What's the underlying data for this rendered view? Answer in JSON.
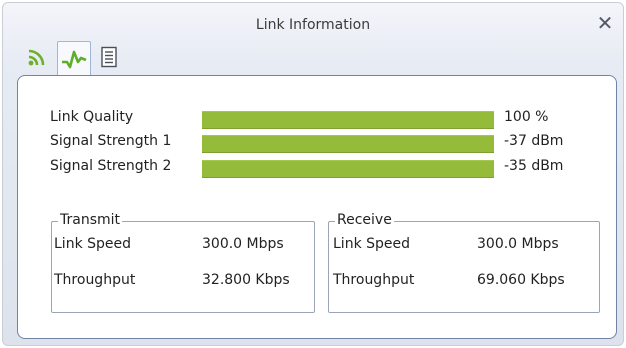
{
  "window": {
    "title": "Link Information",
    "close_glyph": "✕"
  },
  "tabs": [
    {
      "name": "signal-tab",
      "icon": "wifi-signal-icon"
    },
    {
      "name": "link-tab",
      "icon": "waveform-icon",
      "active": true
    },
    {
      "name": "info-tab",
      "icon": "document-icon"
    }
  ],
  "quality": [
    {
      "label": "Link Quality",
      "value": "100 %",
      "level": 1.0
    },
    {
      "label": "Signal Strength 1",
      "value": "-37 dBm",
      "level": 1.0
    },
    {
      "label": "Signal Strength 2",
      "value": "-35 dBm",
      "level": 1.0
    }
  ],
  "transmit": {
    "title": "Transmit",
    "link_speed_label": "Link Speed",
    "link_speed_value": "300.0 Mbps",
    "throughput_label": "Throughput",
    "throughput_value": "32.800 Kbps"
  },
  "receive": {
    "title": "Receive",
    "link_speed_label": "Link Speed",
    "link_speed_value": "300.0 Mbps",
    "throughput_label": "Throughput",
    "throughput_value": "69.060 Kbps"
  },
  "colors": {
    "bar": "#90b53a",
    "accent_border": "#6f84a6"
  }
}
